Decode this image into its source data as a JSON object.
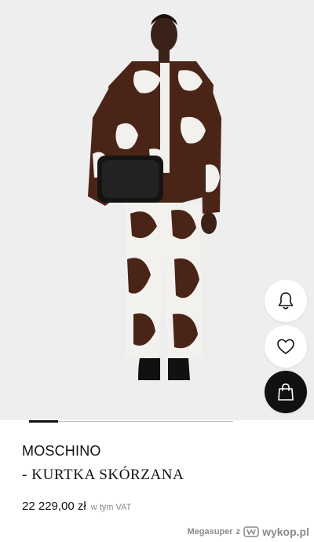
{
  "product": {
    "image_alt": "Model wearing cow-print jacket and trousers holding black bag",
    "brand": "MOSCHINO",
    "name": "- KURTKA SKÓRZANA",
    "price": "22 229,00 zł",
    "vat_note": "w tym VAT"
  },
  "actions": {
    "notify_icon": "bell-icon",
    "wishlist_icon": "heart-icon",
    "cart_icon": "shopping-bag-icon"
  },
  "gallery": {
    "current_index": 1,
    "total": 7
  },
  "watermark": {
    "user": "Megasuper",
    "z": "z",
    "site": "wykop.pl"
  },
  "colors": {
    "background": "#eeeeef",
    "accent_dark": "#111111",
    "cow_brown": "#4a2417",
    "cow_white": "#f3f1ee"
  }
}
